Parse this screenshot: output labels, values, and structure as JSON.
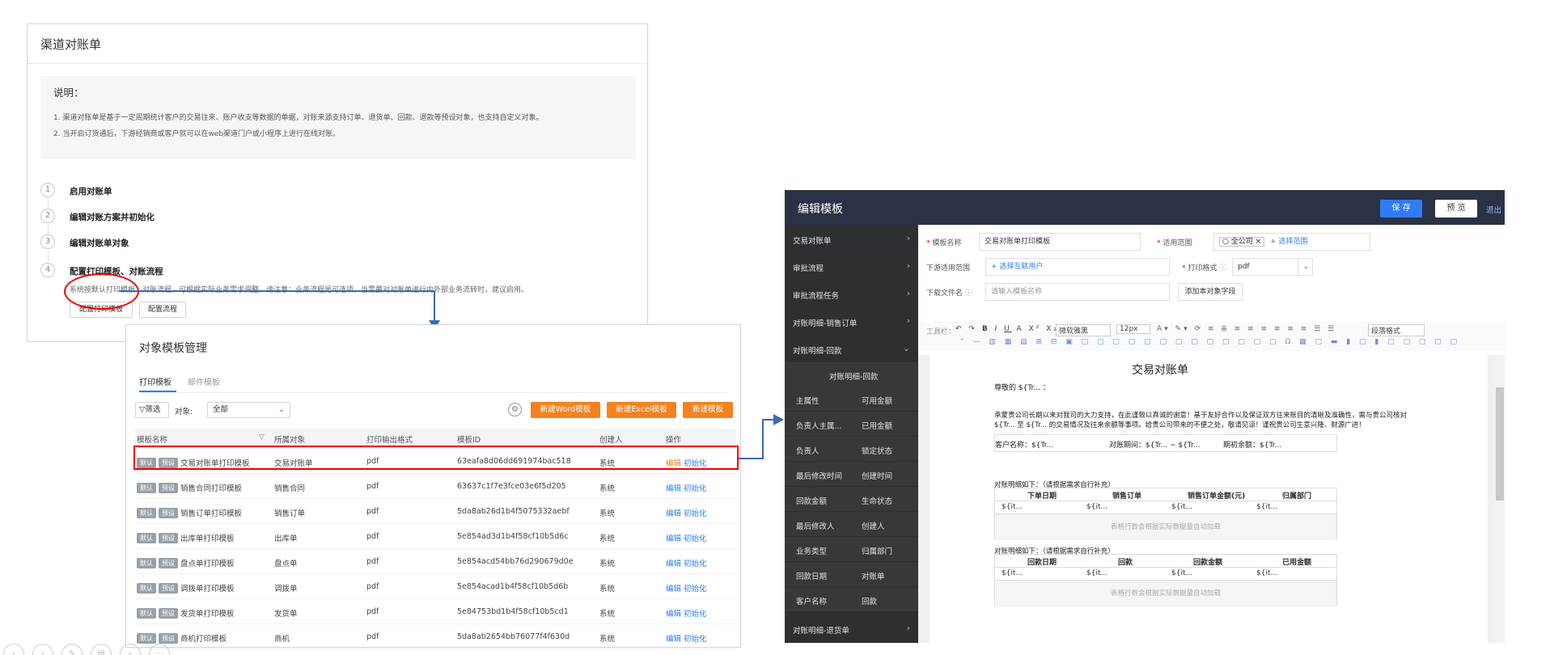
{
  "channel_statement": {
    "title": "渠道对账单",
    "desc_title": "说明：",
    "desc_lines": [
      "1. 渠道对账单是基于一定周期统计客户的交易往来、账户收支等数据的单据，对账来源支持订单、退货单、回款、退款等预设对象，也支持自定义对象。",
      "2. 当开启订货通后，下游经销商或客户就可以在web渠道门户或小程序上进行在线对账。"
    ],
    "steps": [
      {
        "num": "1",
        "label": "启用对账单"
      },
      {
        "num": "2",
        "label": "编辑对账方案并初始化"
      },
      {
        "num": "3",
        "label": "编辑对账单对象"
      },
      {
        "num": "4",
        "label": "配置打印模板、对账流程"
      }
    ],
    "step4_note": "系统按默认打印模板、对账流程，可根据实际业务需求调整。请注意：业务流程是可选项，当需要对对账单进行内外部业务流转时，建议启用。",
    "btn_print_template": "配置打印模板",
    "btn_flow": "配置流程"
  },
  "template_mgmt": {
    "title": "对象模板管理",
    "tabs": [
      "打印模板",
      "邮件模板"
    ],
    "filter_label": "筛选",
    "object_label": "对象:",
    "object_value": "全部",
    "btn_word": "新建Word模板",
    "btn_excel": "新建Excel模板",
    "btn_new": "新建模板",
    "columns": [
      "模板名称",
      "所属对象",
      "打印输出格式",
      "模板ID",
      "创建人",
      "操作"
    ],
    "tag_default": "默认",
    "tag_preset": "预设",
    "action_edit": "编辑",
    "action_init": "初始化",
    "rows": [
      {
        "name": "交易对账单打印模板",
        "object": "交易对账单",
        "format": "pdf",
        "id": "63eafa8d06dd691974bac518",
        "creator": "系统"
      },
      {
        "name": "销售合同打印模板",
        "object": "销售合同",
        "format": "pdf",
        "id": "63637c1f7e3fce03e6f5d205",
        "creator": "系统"
      },
      {
        "name": "销售订单打印模板",
        "object": "销售订单",
        "format": "pdf",
        "id": "5da8ab26d1b4f5075332aebf",
        "creator": "系统"
      },
      {
        "name": "出库单打印模板",
        "object": "出库单",
        "format": "pdf",
        "id": "5e854ad3d1b4f58cf10b5d6c",
        "creator": "系统"
      },
      {
        "name": "盘点单打印模板",
        "object": "盘点单",
        "format": "pdf",
        "id": "5e854acd54bb76d290679d0e",
        "creator": "系统"
      },
      {
        "name": "调拨单打印模板",
        "object": "调拨单",
        "format": "pdf",
        "id": "5e854acad1b4f58cf10b5d6b",
        "creator": "系统"
      },
      {
        "name": "发货单打印模板",
        "object": "发货单",
        "format": "pdf",
        "id": "5e84753bd1b4f58cf10b5cd1",
        "creator": "系统"
      },
      {
        "name": "商机打印模板",
        "object": "商机",
        "format": "pdf",
        "id": "5da8ab2654bb76077f4f630d",
        "creator": "系统"
      }
    ]
  },
  "edit_template": {
    "title": "编辑模板",
    "btn_save": "保 存",
    "btn_preview": "预 览",
    "btn_exit": "退出",
    "sidebar": [
      {
        "label": "交易对账单",
        "chevron": "›"
      },
      {
        "label": "审批流程",
        "chevron": "›"
      },
      {
        "label": "审批流程任务",
        "chevron": "›"
      },
      {
        "label": "对账明细-销售订单",
        "chevron": "›"
      },
      {
        "label": "对账明细-回款",
        "chevron": "⌄"
      }
    ],
    "sub_header": "对账明细-回款",
    "sub_fields": [
      [
        "主属性",
        "可用金额"
      ],
      [
        "负责人主属...",
        "已用金额"
      ],
      [
        "负责人",
        "锁定状态"
      ],
      [
        "最后修改时间",
        "创建时间"
      ],
      [
        "回款金额",
        "生命状态"
      ],
      [
        "最后修改人",
        "创建人"
      ],
      [
        "业务类型",
        "归属部门"
      ],
      [
        "回款日期",
        "对账单"
      ],
      [
        "客户名称",
        "回款"
      ]
    ],
    "sidebar_last": "对账明细-退货单",
    "form": {
      "name_label": "模板名称",
      "name_value": "交易对账单打印模板",
      "scope_label": "适用范围",
      "scope_value": "全公司",
      "scope_add": "+ 选择范围",
      "downstream_label": "下游适用范围",
      "downstream_add": "+ 选择互联用户",
      "format_label": "打印格式",
      "format_value": "pdf",
      "filename_label": "下载文件名",
      "filename_placeholder": "请输入模板名称",
      "add_field_btn": "添加本对象字段"
    },
    "toolbar": {
      "label": "工具栏：",
      "font": "微软雅黑",
      "size": "12px",
      "para": "段落格式"
    },
    "doc": {
      "title": "交易对账单",
      "greeting": "尊敬的 ${Tr... ：",
      "body1": "承蒙贵公司长期以来对我司的大力支持，在此谨致以真诚的谢意！基于友好合作以及保证双方往来账目的清晰及准确性，需与贵公司核对",
      "body2": "${Tr... 至 ${Tr... 的交易情况及往来余额等事项。给贵公司带来的不便之处，敬请见谅！谨祝贵公司生意兴隆、财源广进！",
      "customer": "客户名称：${Tr...",
      "period": "对账期间：${Tr... ~ ${Tr...",
      "opening": "期初余额：${Tr...",
      "detail_title": "对账明细如下：（请根据需求自行补充）",
      "table1_cols": [
        "下单日期",
        "销售订单",
        "销售订单金额(元)",
        "归属部门"
      ],
      "table2_cols": [
        "回款日期",
        "回款",
        "回款金额",
        "已用金额"
      ],
      "cell_placeholder": "${it...",
      "footer_note": "表格行数会根据实际数据量自动加载"
    }
  },
  "controls": [
    "‹",
    "›",
    "✎",
    "▤",
    "⌕",
    "⋯"
  ]
}
